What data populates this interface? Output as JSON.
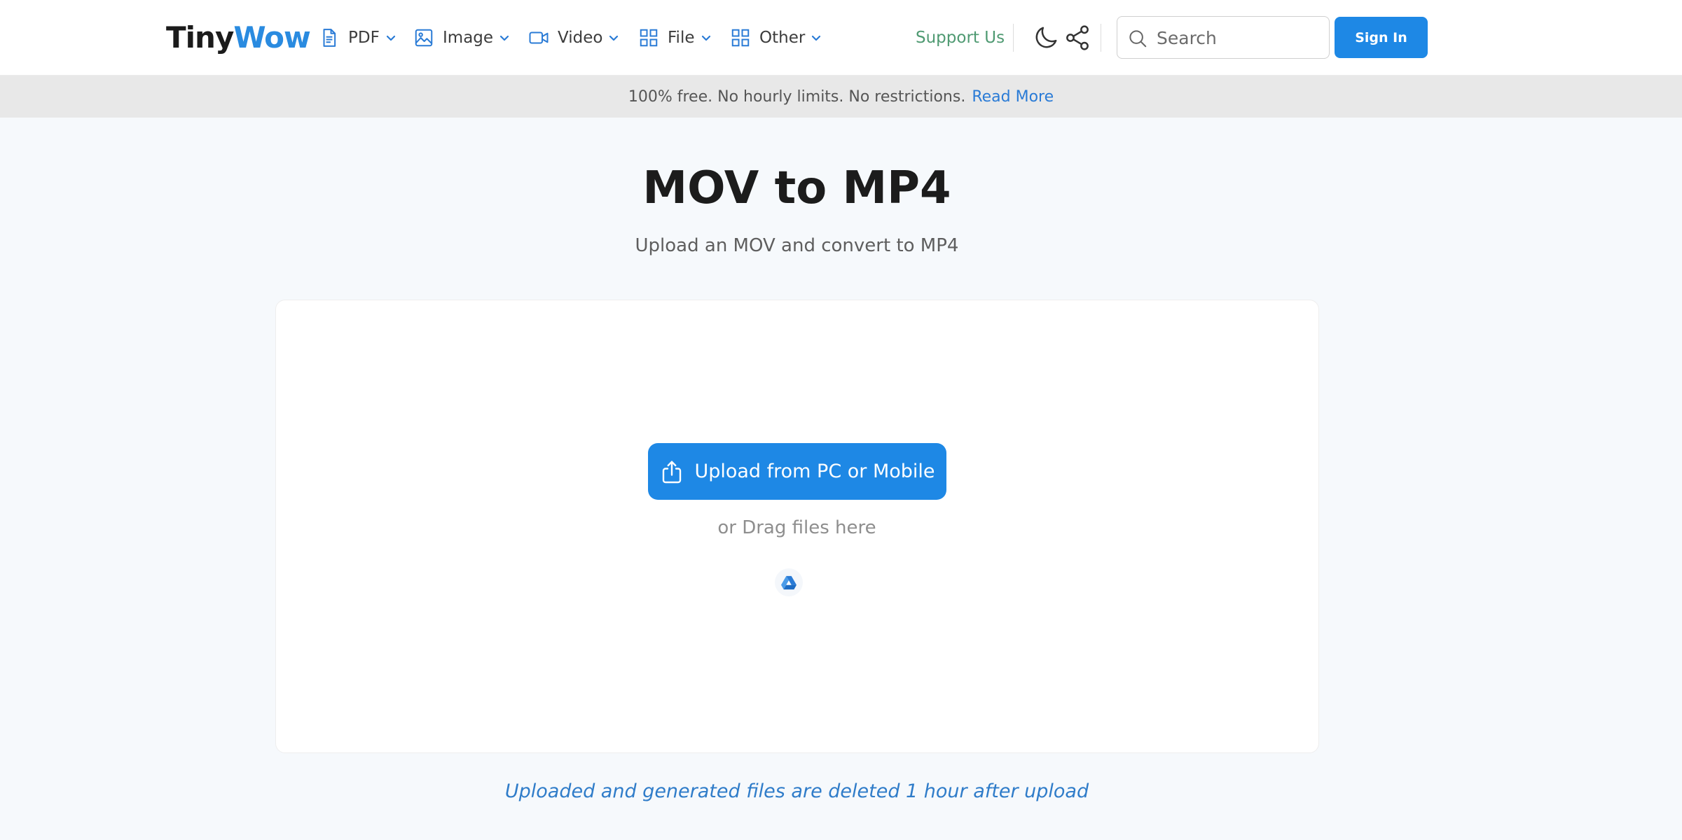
{
  "header": {
    "logo_part1": "Tiny",
    "logo_part2": "Wow",
    "nav": [
      {
        "label": "PDF",
        "icon": "document-icon"
      },
      {
        "label": "Image",
        "icon": "image-icon"
      },
      {
        "label": "Video",
        "icon": "video-camera-icon"
      },
      {
        "label": "File",
        "icon": "grid-icon"
      },
      {
        "label": "Other",
        "icon": "grid-icon"
      }
    ],
    "support_label": "Support Us",
    "search_placeholder": "Search",
    "signin_label": "Sign In"
  },
  "banner": {
    "text": "100% free. No hourly limits. No restrictions.",
    "link": "Read More"
  },
  "main": {
    "title": "MOV to MP4",
    "subtitle": "Upload an MOV and convert to MP4",
    "upload_label": "Upload from PC or Mobile",
    "drag_text": "or Drag files here",
    "note": "Uploaded and generated files are deleted 1 hour after upload"
  },
  "colors": {
    "accent": "#1e88e5",
    "logo_blue": "#2a8be0",
    "support_green": "#4f9a72",
    "banner_bg": "#e8e8e8",
    "page_bg": "#f6f9fc"
  }
}
